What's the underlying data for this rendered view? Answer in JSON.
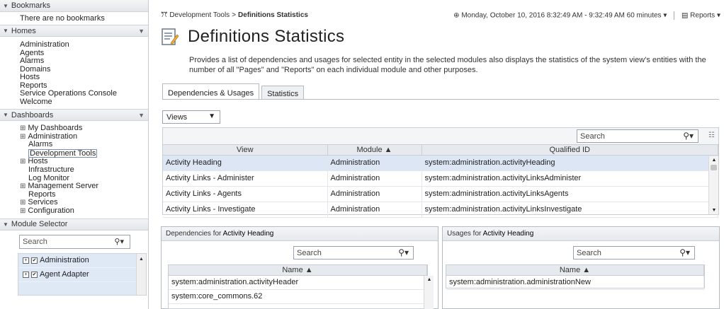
{
  "sidebar": {
    "bookmarks": {
      "title": "Bookmarks",
      "empty": "There are no bookmarks"
    },
    "homes": {
      "title": "Homes",
      "items": [
        "Administration",
        "Agents",
        "Alarms",
        "Domains",
        "Hosts",
        "Reports",
        "Service Operations Console",
        "Welcome"
      ]
    },
    "dashboards": {
      "title": "Dashboards",
      "items": [
        {
          "label": "My Dashboards",
          "expandable": true
        },
        {
          "label": "Administration",
          "expandable": true
        },
        {
          "label": "Alarms",
          "expandable": false
        },
        {
          "label": "Development Tools",
          "expandable": false,
          "selected": true
        },
        {
          "label": "Hosts",
          "expandable": true
        },
        {
          "label": "Infrastructure",
          "expandable": false
        },
        {
          "label": "Log Monitor",
          "expandable": false
        },
        {
          "label": "Management Server",
          "expandable": true
        },
        {
          "label": "Reports",
          "expandable": false
        },
        {
          "label": "Services",
          "expandable": true
        },
        {
          "label": "Configuration",
          "expandable": true
        }
      ]
    },
    "module_selector": {
      "title": "Module Selector",
      "search_placeholder": "Search",
      "items": [
        "Administration",
        "Agent Adapter"
      ]
    }
  },
  "topbar": {
    "breadcrumb_parent": "Development Tools",
    "breadcrumb_current": "Definitions Statistics",
    "time_range": "Monday, October 10, 2016 8:32:49 AM - 9:32:49 AM 60 minutes",
    "reports_label": "Reports"
  },
  "page": {
    "title": "Definitions Statistics",
    "description": "Provides a list of dependencies and usages for selected entity in the selected modules also displays the statistics of the system view's entities with the number of all \"Pages\" and \"Reports\" on each individual module and other purposes."
  },
  "tabs": [
    "Dependencies & Usages",
    "Statistics"
  ],
  "views_dropdown": {
    "selected": "Views"
  },
  "main_grid": {
    "search_placeholder": "Search",
    "columns": [
      "View",
      "Module ▲",
      "Qualified ID"
    ],
    "rows": [
      [
        "Activity Heading",
        "Administration",
        "system:administration.activityHeading"
      ],
      [
        "Activity Links - Administer",
        "Administration",
        "system:administration.activityLinksAdminister"
      ],
      [
        "Activity Links - Agents",
        "Administration",
        "system:administration.activityLinksAgents"
      ],
      [
        "Activity Links - Investigate",
        "Administration",
        "system:administration.activityLinksInvestigate"
      ]
    ]
  },
  "dependencies_panel": {
    "title_prefix": "Dependencies for",
    "entity": "Activity Heading",
    "search_placeholder": "Search",
    "column": "Name ▲",
    "rows": [
      "system:administration.activityHeader",
      "system:core_commons.62"
    ]
  },
  "usages_panel": {
    "title_prefix": "Usages for",
    "entity": "Activity Heading",
    "search_placeholder": "Search",
    "column": "Name ▲",
    "rows": [
      "system:administration.administrationNew"
    ]
  }
}
